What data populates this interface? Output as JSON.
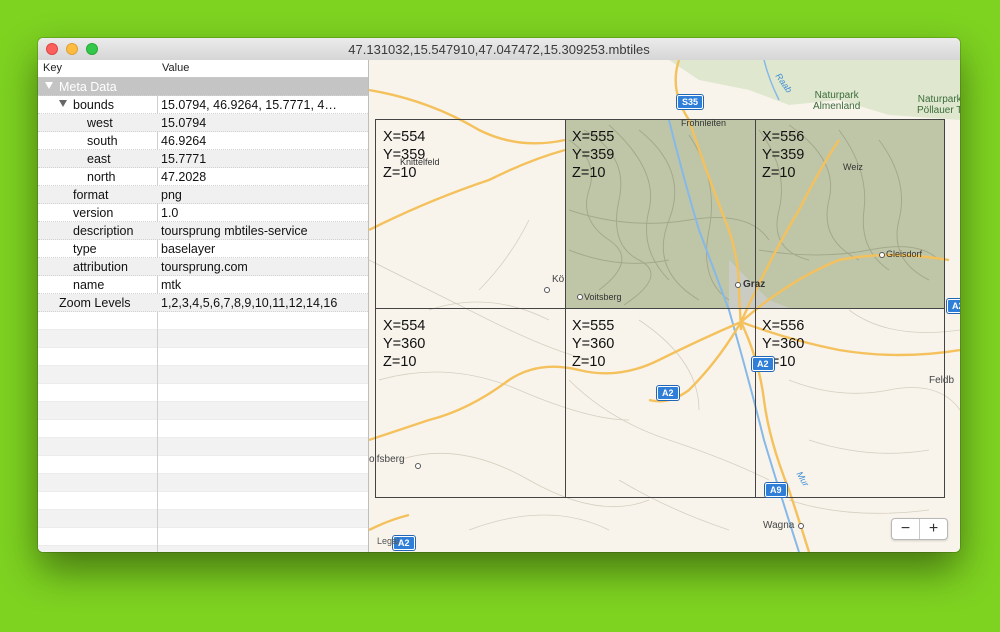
{
  "window": {
    "title": "47.131032,15.547910,47.047472,15.309253.mbtiles"
  },
  "outline": {
    "columns": {
      "key": "Key",
      "value": "Value"
    },
    "group": "Meta Data",
    "rows": [
      {
        "key": "bounds",
        "value": "15.0794, 46.9264, 15.7771, 4…"
      },
      {
        "key": "west",
        "value": "15.0794"
      },
      {
        "key": "south",
        "value": "46.9264"
      },
      {
        "key": "east",
        "value": "15.7771"
      },
      {
        "key": "north",
        "value": "47.2028"
      },
      {
        "key": "format",
        "value": "png"
      },
      {
        "key": "version",
        "value": "1.0"
      },
      {
        "key": "description",
        "value": "toursprung mbtiles-service"
      },
      {
        "key": "type",
        "value": "baselayer"
      },
      {
        "key": "attribution",
        "value": "toursprung.com"
      },
      {
        "key": "name",
        "value": "mtk"
      },
      {
        "key": "Zoom Levels",
        "value": "1,2,3,4,5,6,7,8,9,10,11,12,14,16"
      }
    ]
  },
  "map": {
    "tiles": [
      {
        "x": "X=554",
        "y": "Y=359",
        "z": "Z=10"
      },
      {
        "x": "X=555",
        "y": "Y=359",
        "z": "Z=10"
      },
      {
        "x": "X=556",
        "y": "Y=359",
        "z": "Z=10"
      },
      {
        "x": "X=554",
        "y": "Y=360",
        "z": "Z=10"
      },
      {
        "x": "X=555",
        "y": "Y=360",
        "z": "Z=10"
      },
      {
        "x": "X=556",
        "y": "Y=360",
        "z": "Z=10"
      }
    ],
    "places": {
      "knittelfeld": "Knittelfeld",
      "frohnleiten": "Frohnleiten",
      "weiz": "Weiz",
      "graz": "Graz",
      "gleisdorf": "Gleisdorf",
      "voitsberg": "Voitsberg",
      "wolfsberg": "olfsberg",
      "wagna": "Wagna",
      "feldbach": "Feldb",
      "koflach": "Kö",
      "naturpark_almenland": "Naturpark\nAlmenland",
      "naturpark_poellauer": "Naturpark\nPöllauer T",
      "raab": "Raab",
      "mur": "Mur"
    },
    "shields": {
      "s35": "S35",
      "a2_center": "A2",
      "a2_graz": "A2",
      "a2_east": "A2",
      "a2_bottom": "A2",
      "a9": "A9"
    },
    "zoom": {
      "minus": "−",
      "plus": "+"
    },
    "legal": "Legal"
  }
}
